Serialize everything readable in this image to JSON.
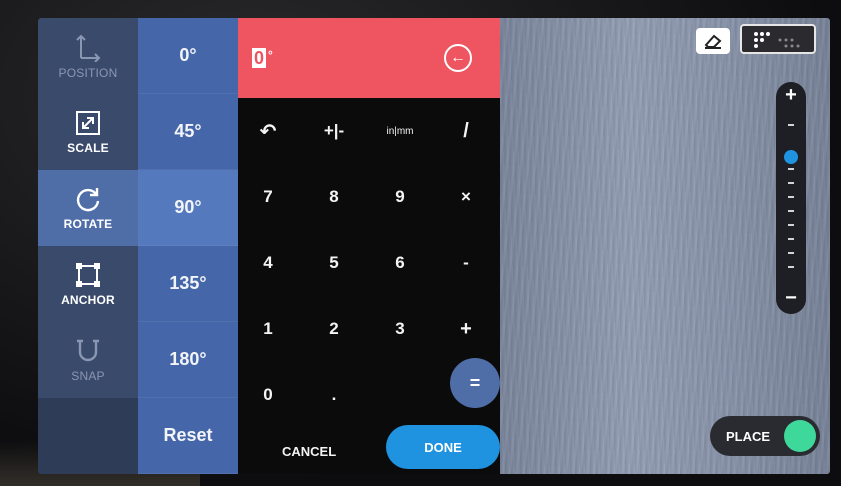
{
  "tools": [
    {
      "label": "POSITION",
      "icon": "position-icon",
      "state": "dim"
    },
    {
      "label": "SCALE",
      "icon": "scale-icon",
      "state": "normal"
    },
    {
      "label": "ROTATE",
      "icon": "rotate-icon",
      "state": "active"
    },
    {
      "label": "ANCHOR",
      "icon": "anchor-icon",
      "state": "normal"
    },
    {
      "label": "SNAP",
      "icon": "snap-icon",
      "state": "dim"
    }
  ],
  "angles": [
    "0°",
    "45°",
    "90°",
    "135°",
    "180°",
    "Reset"
  ],
  "keypad": {
    "display_value": "0",
    "display_unit": "°",
    "top_row": [
      "↶",
      "+|-",
      "in|mm",
      "/"
    ],
    "rows": [
      [
        "7",
        "8",
        "9",
        "×"
      ],
      [
        "4",
        "5",
        "6",
        "-"
      ],
      [
        "1",
        "2",
        "3",
        "+"
      ],
      [
        "0",
        "."
      ]
    ],
    "equals": "=",
    "cancel": "CANCEL",
    "done": "DONE"
  },
  "camera": {
    "place_label": "PLACE",
    "place_on": true,
    "zoom_plus": "+",
    "zoom_minus": "−",
    "zoom_level": 0.8
  },
  "colors": {
    "display_red": "#ee5560",
    "accent_blue": "#1f93e0",
    "tool_blue": "#4f6ea8",
    "toggle_green": "#3fd89b"
  }
}
